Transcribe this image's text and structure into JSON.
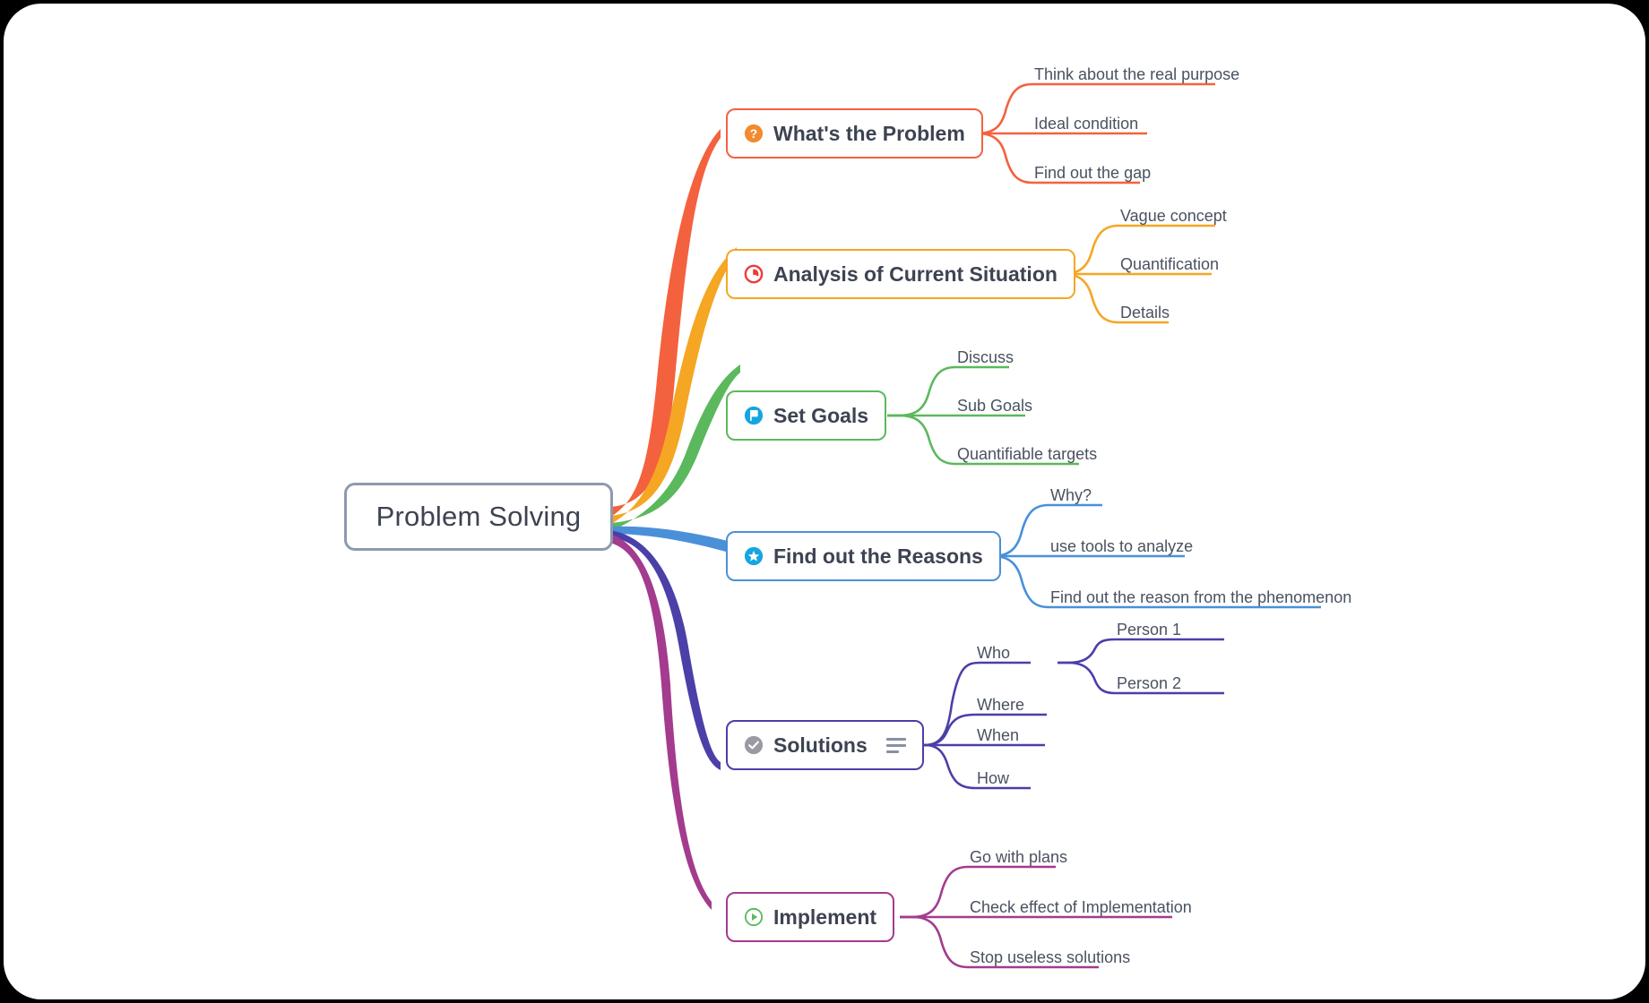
{
  "document": {
    "title": "Problem Solving",
    "type": "mind-map"
  },
  "colors": {
    "root_border": "#8d99ae",
    "text_dark": "#3d4351",
    "text_leaf": "#4a5260",
    "branch_1": "#f4613e",
    "branch_2": "#f5a623",
    "branch_3": "#5cb85c",
    "branch_4": "#4a90d9",
    "branch_5": "#4b3fa8",
    "branch_6": "#a33b8e",
    "icon_problem": "#f28a30",
    "icon_clock": "#ef3b36",
    "icon_goals": "#16a5e0",
    "icon_reasons": "#16a5e0",
    "icon_solutions": "#9a9aa5",
    "icon_implement": "#5cb85c",
    "notes_icon": "#8a8fa3",
    "canvas": "#ffffff",
    "page": "#000000"
  },
  "root": {
    "label": "Problem Solving"
  },
  "branches": [
    {
      "id": "whats-the-problem",
      "label": "What's the Problem",
      "icon": "question-circle-icon",
      "color": "#f4613e",
      "children": [
        {
          "label": "Think about the real purpose"
        },
        {
          "label": "Ideal condition"
        },
        {
          "label": "Find out the gap"
        }
      ]
    },
    {
      "id": "analysis-of-current-situation",
      "label": "Analysis of Current Situation",
      "icon": "clock-icon",
      "color": "#f5a623",
      "children": [
        {
          "label": "Vague concept"
        },
        {
          "label": "Quantification"
        },
        {
          "label": "Details"
        }
      ]
    },
    {
      "id": "set-goals",
      "label": "Set Goals",
      "icon": "flag-circle-icon",
      "color": "#5cb85c",
      "children": [
        {
          "label": "Discuss"
        },
        {
          "label": "Sub Goals"
        },
        {
          "label": "Quantifiable targets"
        }
      ]
    },
    {
      "id": "find-out-the-reasons",
      "label": "Find out the Reasons",
      "icon": "star-circle-icon",
      "color": "#4a90d9",
      "children": [
        {
          "label": "Why?"
        },
        {
          "label": "use tools to analyze"
        },
        {
          "label": "Find out the reason from the phenomenon"
        }
      ]
    },
    {
      "id": "solutions",
      "label": "Solutions",
      "icon": "check-circle-icon",
      "badge_icon": "notes-icon",
      "color": "#4b3fa8",
      "children": [
        {
          "label": "Who",
          "children": [
            {
              "label": "Person 1"
            },
            {
              "label": "Person 2"
            }
          ]
        },
        {
          "label": "Where"
        },
        {
          "label": "When"
        },
        {
          "label": "How"
        }
      ]
    },
    {
      "id": "implement",
      "label": "Implement",
      "icon": "play-circle-icon",
      "color": "#a33b8e",
      "children": [
        {
          "label": "Go with plans"
        },
        {
          "label": "Check effect of Implementation"
        },
        {
          "label": "Stop useless solutions"
        }
      ]
    }
  ]
}
